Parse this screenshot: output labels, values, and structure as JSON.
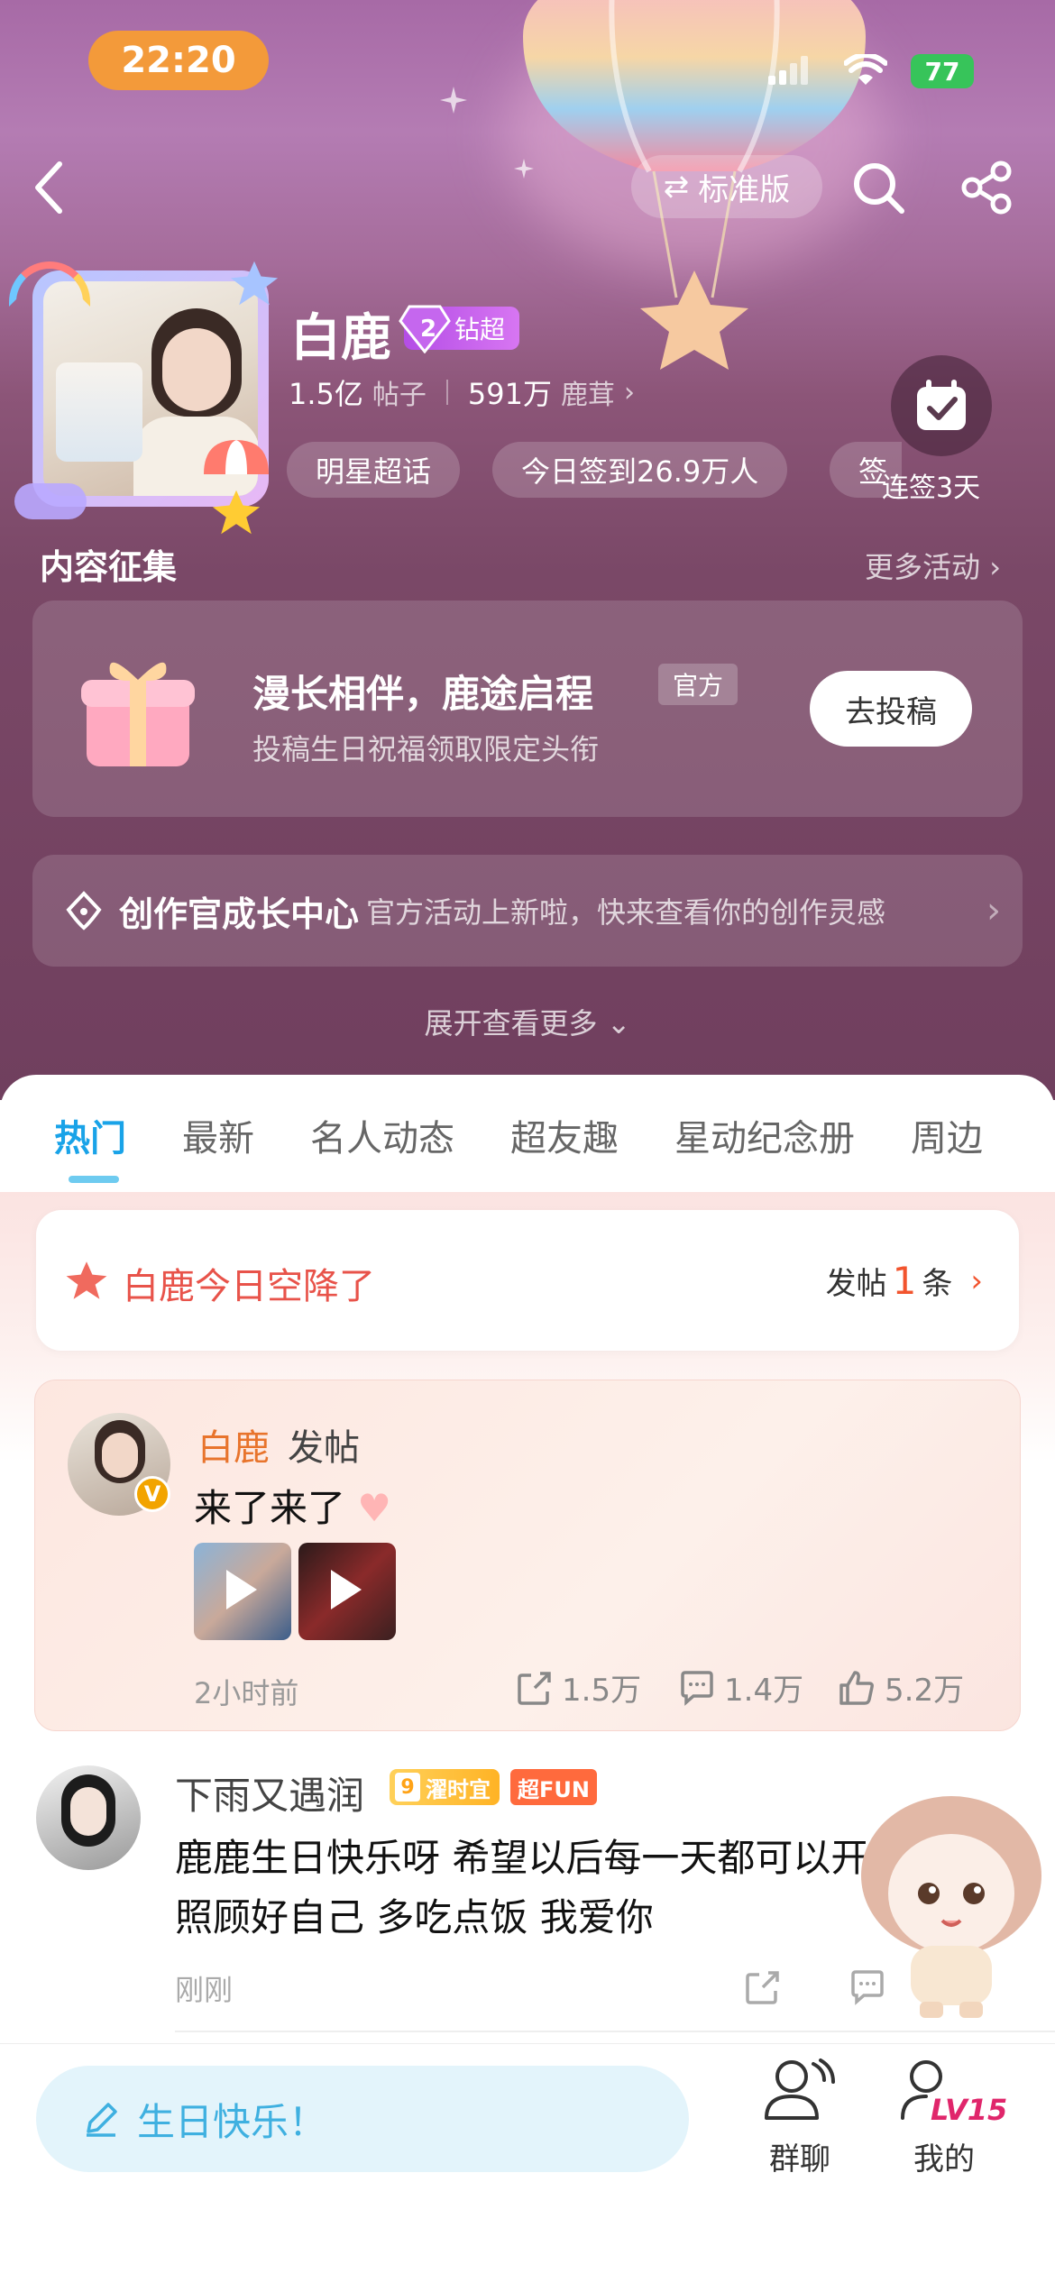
{
  "status": {
    "time": "22:20",
    "battery": "77"
  },
  "header": {
    "mode_label": "标准版"
  },
  "profile": {
    "name": "白鹿",
    "badge_level": "2",
    "badge_text": "钻超",
    "posts_count": "1.5亿",
    "posts_label": "帖子",
    "fans_count": "591万",
    "fans_label": "鹿茸",
    "pills": [
      "明星超话",
      "今日签到26.9万人",
      "签"
    ],
    "checkin_label": "连签3天"
  },
  "collection": {
    "title": "内容征集",
    "more": "更多活动",
    "card_title": "漫长相伴，鹿途启程",
    "card_tag": "官方",
    "card_sub": "投稿生日祝福领取限定头衔",
    "card_button": "去投稿"
  },
  "creator": {
    "title": "创作官成长中心",
    "sub": "官方活动上新啦，快来查看你的创作灵感"
  },
  "expand_label": "展开查看更多",
  "tabs": [
    "热门",
    "最新",
    "名人动态",
    "超友趣",
    "星动纪念册",
    "周边"
  ],
  "airdrop": {
    "title": "白鹿今日空降了",
    "prefix": "发帖",
    "count": "1",
    "suffix": "条"
  },
  "post": {
    "author": "白鹿",
    "action": "发帖",
    "text": "来了来了",
    "time": "2小时前",
    "shares": "1.5万",
    "comments": "1.4万",
    "likes": "5.2万"
  },
  "comment": {
    "author": "下雨又遇润",
    "level_num": "9",
    "level_text": "濯时宜",
    "fun_tag": "超FUN",
    "text": "鹿鹿生日快乐呀 希望以后每一天都可以开心 一定要照顾好自己 多吃点饭 我爱你",
    "time": "刚刚"
  },
  "bottom": {
    "input_placeholder": "生日快乐！",
    "group_chat": "群聊",
    "mine": "我的",
    "mine_level": "LV15"
  },
  "colors": {
    "accent_blue": "#19a3e8",
    "hero_top": "#a76aa6",
    "hero_bottom": "#703f5e",
    "orange": "#f39a3a"
  }
}
